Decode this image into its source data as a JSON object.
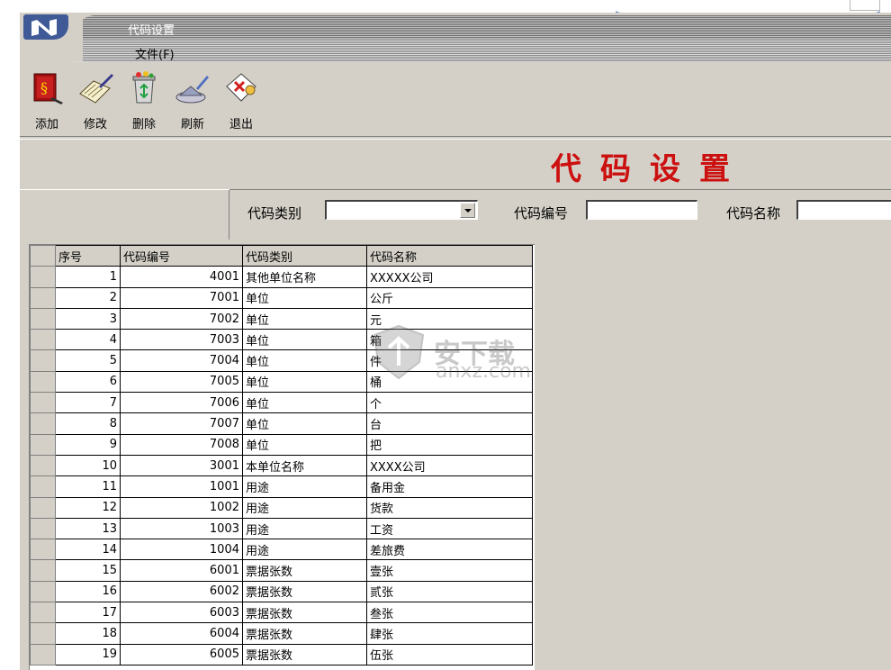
{
  "window": {
    "title": "代码设置"
  },
  "menu": {
    "file": "文件(F)"
  },
  "toolbar": [
    {
      "label": "添加",
      "icon": "add-book-icon"
    },
    {
      "label": "修改",
      "icon": "edit-pen-icon"
    },
    {
      "label": "删除",
      "icon": "recycle-bin-icon"
    },
    {
      "label": "刷新",
      "icon": "brush-refresh-icon"
    },
    {
      "label": "退出",
      "icon": "exit-icon"
    }
  ],
  "panel": {
    "title": "代码设置"
  },
  "filters": {
    "category_label": "代码类别",
    "category_value": "",
    "code_label": "代码编号",
    "code_value": "",
    "name_label": "代码名称",
    "name_value": ""
  },
  "table": {
    "columns": [
      "序号",
      "代码编号",
      "代码类别",
      "代码名称"
    ],
    "rows": [
      [
        "1",
        "4001",
        "其他单位名称",
        "XXXXX公司"
      ],
      [
        "2",
        "7001",
        "单位",
        "公斤"
      ],
      [
        "3",
        "7002",
        "单位",
        "元"
      ],
      [
        "4",
        "7003",
        "单位",
        "箱"
      ],
      [
        "5",
        "7004",
        "单位",
        "件"
      ],
      [
        "6",
        "7005",
        "单位",
        "桶"
      ],
      [
        "7",
        "7006",
        "单位",
        "个"
      ],
      [
        "8",
        "7007",
        "单位",
        "台"
      ],
      [
        "9",
        "7008",
        "单位",
        "把"
      ],
      [
        "10",
        "3001",
        "本单位名称",
        "XXXX公司"
      ],
      [
        "11",
        "1001",
        "用途",
        "备用金"
      ],
      [
        "12",
        "1002",
        "用途",
        "货款"
      ],
      [
        "13",
        "1003",
        "用途",
        "工资"
      ],
      [
        "14",
        "1004",
        "用途",
        "差旅费"
      ],
      [
        "15",
        "6001",
        "票据张数",
        "壹张"
      ],
      [
        "16",
        "6002",
        "票据张数",
        "贰张"
      ],
      [
        "17",
        "6003",
        "票据张数",
        "叁张"
      ],
      [
        "18",
        "6004",
        "票据张数",
        "肆张"
      ],
      [
        "19",
        "6005",
        "票据张数",
        "伍张"
      ]
    ]
  },
  "watermark": {
    "text": "安下载",
    "sub": "anxz.com"
  },
  "colors": {
    "title_red": "#cc1010",
    "logo_blue": "#405a98",
    "face": "#d4d0c8"
  }
}
